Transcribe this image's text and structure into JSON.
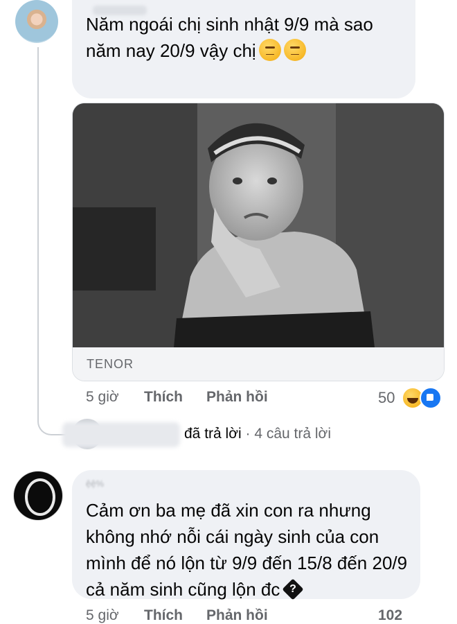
{
  "comments": [
    {
      "text": "Năm ngoái chị sinh nhật 9/9 mà sao năm nay 20/9 vậy chị",
      "emoji": [
        "thinking-face",
        "thinking-face"
      ],
      "attachment": {
        "label": "TENOR"
      },
      "time": "5 giờ",
      "like_label": "Thích",
      "reply_label": "Phản hồi",
      "reaction_count": "50",
      "reactions": [
        "haha",
        "like"
      ]
    },
    {
      "author_partial": "ệệ%",
      "text": "Cảm ơn ba mẹ đã xin con ra nhưng không nhớ nỗi cái ngày sinh của con mình để nó lộn từ 9/9 đến 15/8 đến 20/9 cả năm sinh cũng lộn đc",
      "end_glyph": "?",
      "time": "5 giờ",
      "like_label": "Thích",
      "reply_label": "Phản hồi",
      "reaction_count": "102"
    }
  ],
  "reply_summary": {
    "action": "đã trả lời",
    "separator": "·",
    "count": "4 câu trả lời"
  },
  "colors": {
    "bubble": "#eff1f5",
    "secondary_text": "#65676b",
    "like_blue": "#1877f2"
  }
}
